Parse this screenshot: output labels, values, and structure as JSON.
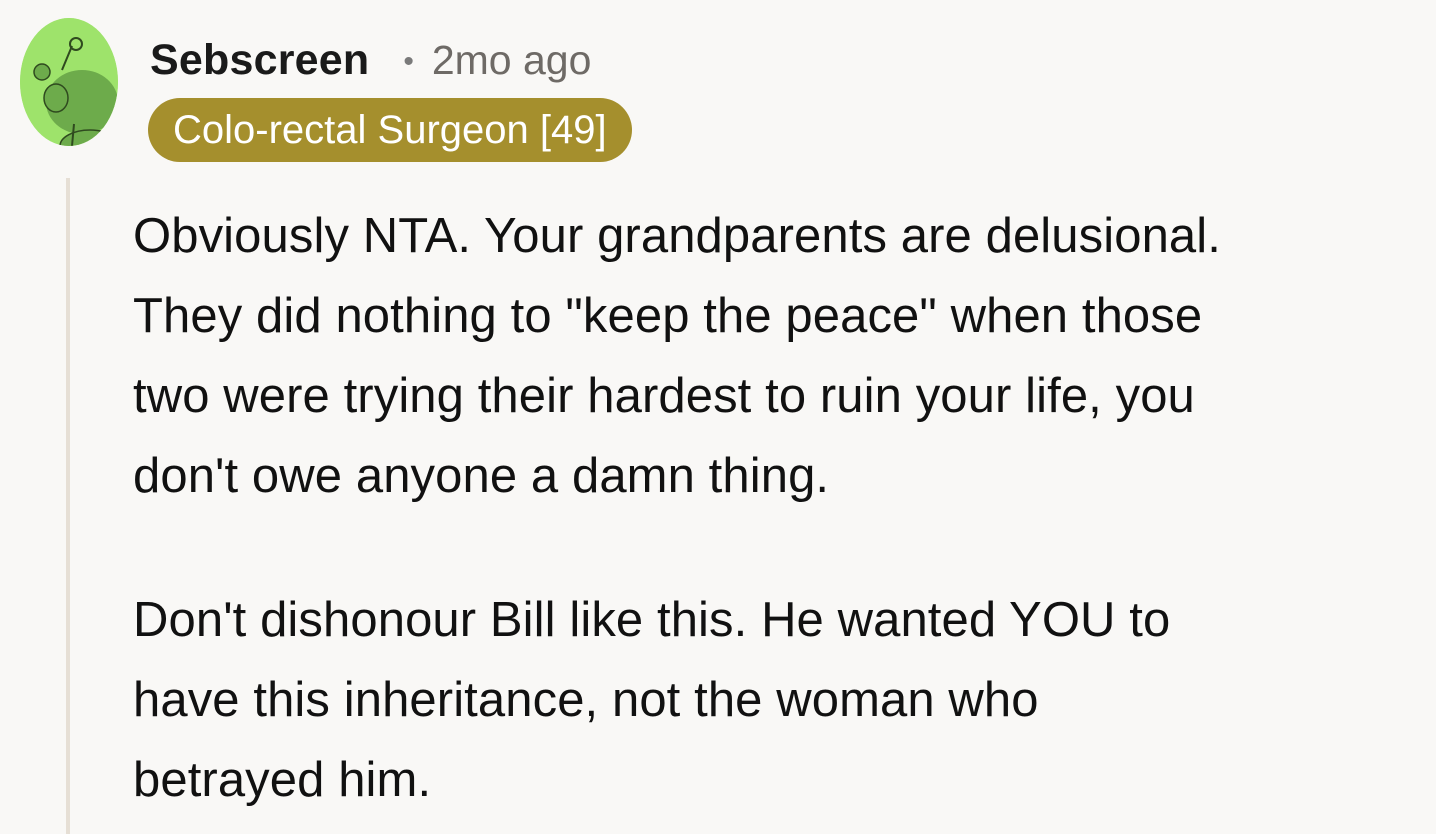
{
  "comment": {
    "avatar_icon": "snoo-avatar-icon",
    "avatar_color": "#9ee36b",
    "username": "Sebscreen",
    "separator": "•",
    "timestamp": "2mo ago",
    "flair": {
      "text": "Colo-rectal Surgeon [49]",
      "color": "#a58f2d"
    },
    "paragraphs": [
      "Obviously NTA. Your grandparents are delusional.\nThey did nothing to \"keep the peace\" when those\ntwo were trying their hardest to ruin your life, you\ndon't owe anyone a damn thing.",
      "Don't dishonour Bill like this. He wanted YOU to\nhave this inheritance, not the woman who\nbetrayed him."
    ]
  }
}
